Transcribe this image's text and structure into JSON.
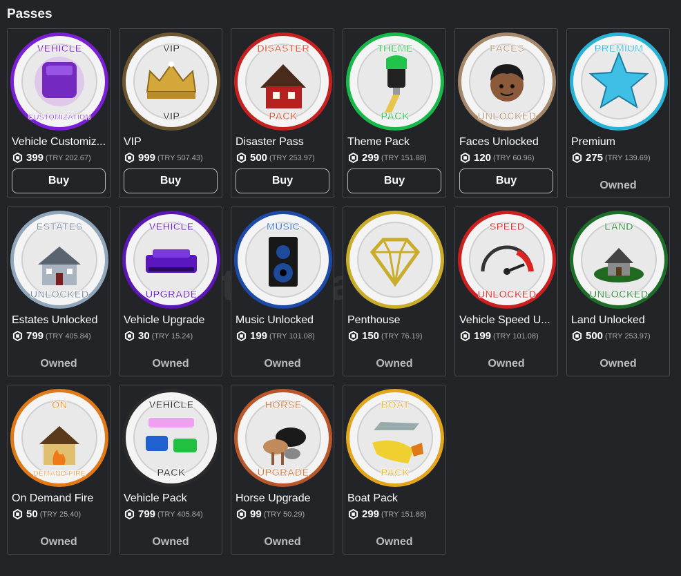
{
  "section_title": "Passes",
  "buy_label": "Buy",
  "owned_label": "Owned",
  "watermark": "itemsatis",
  "passes": [
    {
      "name": "Vehicle Customiz...",
      "robux": "399",
      "try": "(TRY 202.67)",
      "status": "buy",
      "icon": "vehicle-customization-badge-icon",
      "ring": "#7a1fd6",
      "top": "VEHICLE",
      "bottom": "CUSTOMIZATION",
      "accent": "#7a1fd6"
    },
    {
      "name": "VIP",
      "robux": "999",
      "try": "(TRY 507.43)",
      "status": "buy",
      "icon": "vip-crown-badge-icon",
      "ring": "#6b5630",
      "top": "VIP",
      "bottom": "VIP",
      "accent": "#2b2b2b"
    },
    {
      "name": "Disaster Pass",
      "robux": "500",
      "try": "(TRY 253.97)",
      "status": "buy",
      "icon": "disaster-pack-badge-icon",
      "ring": "#c52121",
      "top": "DISASTER",
      "bottom": "PACK",
      "accent": "#e04a2a"
    },
    {
      "name": "Theme Pack",
      "robux": "299",
      "try": "(TRY 151.88)",
      "status": "buy",
      "icon": "theme-pack-badge-icon",
      "ring": "#19b84a",
      "top": "THEME",
      "bottom": "PACK",
      "accent": "#27c24e"
    },
    {
      "name": "Faces Unlocked",
      "robux": "120",
      "try": "(TRY 60.96)",
      "status": "buy",
      "icon": "faces-unlocked-badge-icon",
      "ring": "#a5876a",
      "top": "FACES",
      "bottom": "UNLOCKED",
      "accent": "#b89878"
    },
    {
      "name": "Premium",
      "robux": "275",
      "try": "(TRY 139.69)",
      "status": "owned",
      "icon": "premium-star-badge-icon",
      "ring": "#28b2d6",
      "top": "PREMIUM",
      "bottom": "",
      "accent": "#2fb8dc"
    },
    {
      "name": "Estates Unlocked",
      "robux": "799",
      "try": "(TRY 405.84)",
      "status": "owned",
      "icon": "estates-unlocked-badge-icon",
      "ring": "#8fa6bb",
      "top": "ESTATES",
      "bottom": "UNLOCKED",
      "accent": "#7f93a6"
    },
    {
      "name": "Vehicle Upgrade",
      "robux": "30",
      "try": "(TRY 15.24)",
      "status": "owned",
      "icon": "vehicle-upgrade-badge-icon",
      "ring": "#5b17b5",
      "top": "VEHICLE",
      "bottom": "UPGRADE",
      "accent": "#6a1ed0"
    },
    {
      "name": "Music Unlocked",
      "robux": "199",
      "try": "(TRY 101.08)",
      "status": "owned",
      "icon": "music-unlocked-badge-icon",
      "ring": "#1c4aa8",
      "top": "MUSIC",
      "bottom": "",
      "accent": "#2f6fd6"
    },
    {
      "name": "Penthouse",
      "robux": "150",
      "try": "(TRY 76.19)",
      "status": "owned",
      "icon": "penthouse-diamond-badge-icon",
      "ring": "#c9ad2a",
      "top": "",
      "bottom": "",
      "accent": "#c9ad2a"
    },
    {
      "name": "Vehicle Speed U...",
      "robux": "199",
      "try": "(TRY 101.08)",
      "status": "owned",
      "icon": "vehicle-speed-badge-icon",
      "ring": "#cc1f1f",
      "top": "SPEED",
      "bottom": "UNLOCKED",
      "accent": "#e02626"
    },
    {
      "name": "Land Unlocked",
      "robux": "500",
      "try": "(TRY 253.97)",
      "status": "owned",
      "icon": "land-unlocked-badge-icon",
      "ring": "#1d6e28",
      "top": "LAND",
      "bottom": "UNLOCKED",
      "accent": "#2a8a33"
    },
    {
      "name": "On Demand Fire",
      "robux": "50",
      "try": "(TRY 25.40)",
      "status": "owned",
      "icon": "on-demand-fire-badge-icon",
      "ring": "#e07a18",
      "top": "ON",
      "bottom": "DEMAND FIRE",
      "accent": "#f08a1c"
    },
    {
      "name": "Vehicle Pack",
      "robux": "799",
      "try": "(TRY 405.84)",
      "status": "owned",
      "icon": "vehicle-pack-badge-icon",
      "ring": "#2a2a2a",
      "top": "VEHICLE",
      "bottom": "PACK",
      "accent": "#2a2a2a"
    },
    {
      "name": "Horse Upgrade",
      "robux": "99",
      "try": "(TRY 50.29)",
      "status": "owned",
      "icon": "horse-upgrade-badge-icon",
      "ring": "#b8572a",
      "top": "HORSE",
      "bottom": "UPGRADE",
      "accent": "#d27a3c"
    },
    {
      "name": "Boat Pack",
      "robux": "299",
      "try": "(TRY 151.88)",
      "status": "owned",
      "icon": "boat-pack-badge-icon",
      "ring": "#e3a51c",
      "top": "BOAT",
      "bottom": "PACK",
      "accent": "#f0b11f"
    }
  ]
}
